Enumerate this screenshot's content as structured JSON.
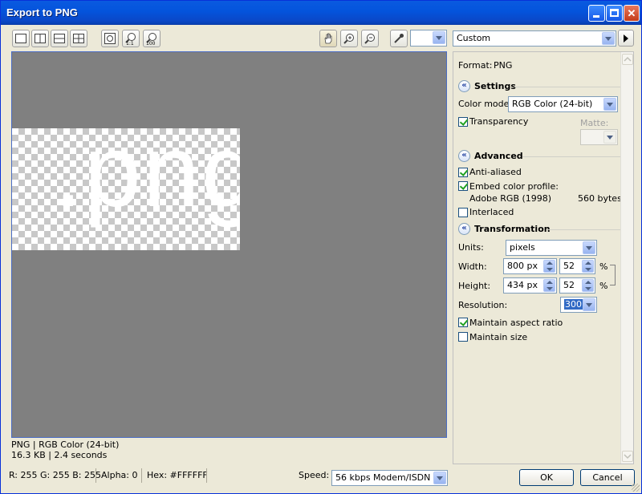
{
  "window": {
    "title": "Export to PNG"
  },
  "toolbar": {
    "mode_select_value": "",
    "preset_select_value": "Custom"
  },
  "preview": {
    "image_text": ".png"
  },
  "info": {
    "line1": "PNG  |  RGB Color (24-bit)",
    "line2": "16.3 KB  |  2.4 seconds"
  },
  "panel": {
    "format_label": "Format:",
    "format_value": "PNG",
    "settings": {
      "title": "Settings",
      "color_mode_label": "Color mode:",
      "color_mode_value": "RGB Color (24-bit)",
      "transparency_label": "Transparency",
      "transparency_checked": true,
      "matte_label": "Matte:"
    },
    "advanced": {
      "title": "Advanced",
      "anti_aliased_label": "Anti-aliased",
      "anti_aliased_checked": true,
      "embed_profile_label": "Embed color profile:",
      "embed_profile_checked": true,
      "profile_name": "Adobe RGB (1998)",
      "profile_size": "560 bytes",
      "interlaced_label": "Interlaced",
      "interlaced_checked": false
    },
    "transformation": {
      "title": "Transformation",
      "units_label": "Units:",
      "units_value": "pixels",
      "width_label": "Width:",
      "width_value": "800 px",
      "width_percent": "52",
      "height_label": "Height:",
      "height_value": "434 px",
      "height_percent": "52",
      "percent_symbol": "%",
      "resolution_label": "Resolution:",
      "resolution_value": "300",
      "maintain_aspect_label": "Maintain aspect ratio",
      "maintain_aspect_checked": true,
      "maintain_size_label": "Maintain size",
      "maintain_size_checked": false
    }
  },
  "status": {
    "rgb": "R: 255   G: 255   B: 255",
    "alpha": "Alpha: 0",
    "hex": "Hex: #FFFFFF",
    "speed_label": "Speed:",
    "speed_value": "56 kbps Modem/ISDN"
  },
  "buttons": {
    "ok": "OK",
    "cancel": "Cancel"
  },
  "colors": {
    "title_bar": "#0454dc",
    "canvas_bg": "#808080",
    "dialog_bg": "#ece9d8"
  }
}
